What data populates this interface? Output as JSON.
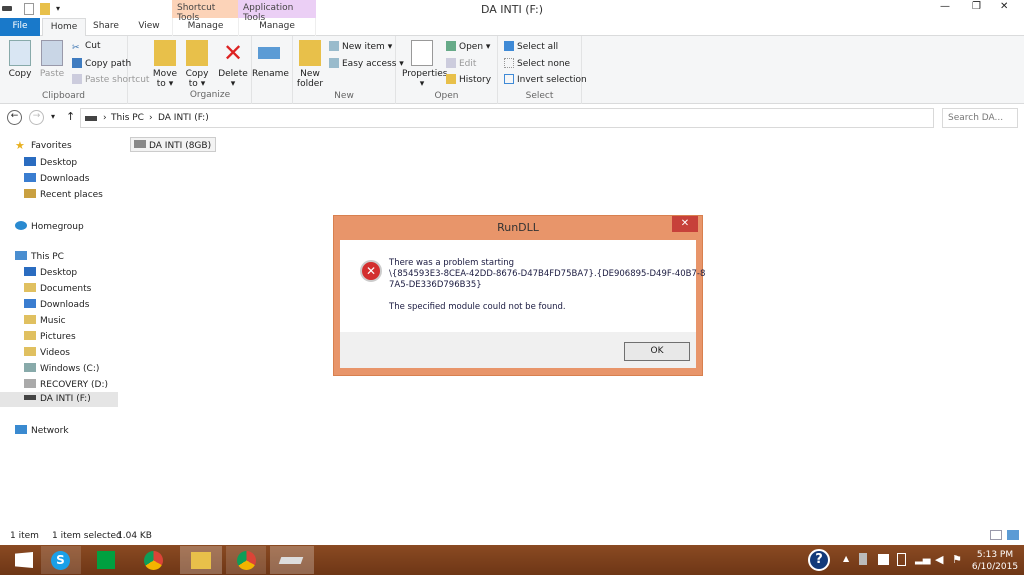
{
  "window": {
    "title": "DA INTI (F:)",
    "context_tabs": [
      "Shortcut Tools",
      "Application Tools"
    ]
  },
  "tabs": {
    "file": "File",
    "home": "Home",
    "share": "Share",
    "view": "View",
    "manage1": "Manage",
    "manage2": "Manage"
  },
  "ribbon": {
    "clipboard": {
      "label": "Clipboard",
      "copy": "Copy",
      "paste": "Paste",
      "cut": "Cut",
      "copy_path": "Copy path",
      "paste_shortcut": "Paste shortcut"
    },
    "organize": {
      "label": "Organize",
      "move_to": "Move to",
      "copy_to": "Copy to",
      "delete": "Delete",
      "rename": "Rename"
    },
    "new": {
      "label": "New",
      "new_folder": "New folder",
      "new_item": "New item",
      "easy_access": "Easy access"
    },
    "open": {
      "label": "Open",
      "properties": "Properties",
      "open": "Open",
      "edit": "Edit",
      "history": "History"
    },
    "select": {
      "label": "Select",
      "select_all": "Select all",
      "select_none": "Select none",
      "invert": "Invert selection"
    }
  },
  "address": {
    "crumbs": [
      "This PC",
      "DA INTI (F:)"
    ],
    "search_placeholder": "Search DA..."
  },
  "nav": {
    "favorites": "Favorites",
    "fav_items": [
      "Desktop",
      "Downloads",
      "Recent places"
    ],
    "homegroup": "Homegroup",
    "this_pc": "This PC",
    "pc_items": [
      "Desktop",
      "Documents",
      "Downloads",
      "Music",
      "Pictures",
      "Videos",
      "Windows (C:)",
      "RECOVERY (D:)",
      "DA INTI (F:)"
    ],
    "network": "Network"
  },
  "content": {
    "file": "DA INTI (8GB)"
  },
  "status": {
    "items": "1 item",
    "selected": "1 item selected",
    "size": "1.04 KB"
  },
  "dialog": {
    "title": "RunDLL",
    "line1": "There was a problem starting",
    "line2": "\\{854593E3-8CEA-42DD-8676-D47B4FD75BA7}.{DE906895-D49F-40B7-8",
    "line3": "7A5-DE336D796B35}",
    "message": "The specified module could not be found.",
    "ok": "OK",
    "close": "✕"
  },
  "taskbar": {
    "time": "5:13 PM",
    "date": "6/10/2015"
  }
}
